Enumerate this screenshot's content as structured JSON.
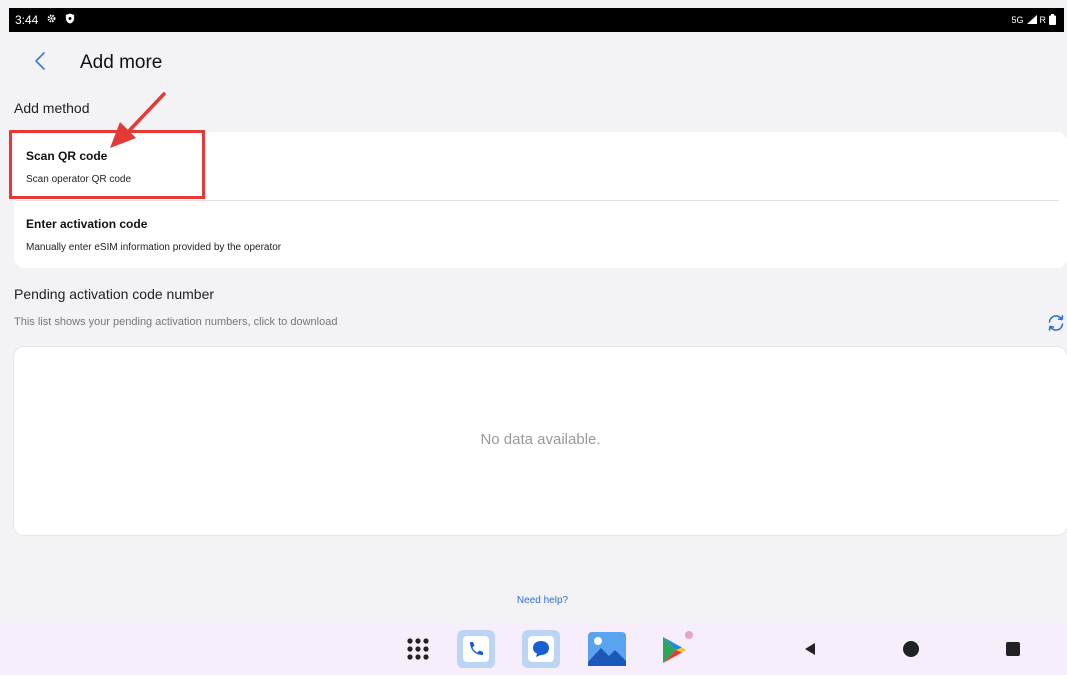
{
  "status_bar": {
    "time": "3:44",
    "network": "5G",
    "roaming": "R",
    "icons": [
      "gear-icon",
      "shield-icon",
      "signal-icon",
      "battery-icon"
    ]
  },
  "header": {
    "title": "Add more",
    "back_icon": "chevron-left-icon"
  },
  "add_method": {
    "section_title": "Add method",
    "items": [
      {
        "title": "Scan QR code",
        "description": "Scan operator QR code"
      },
      {
        "title": "Enter activation code",
        "description": "Manually enter eSIM information provided by the operator"
      }
    ]
  },
  "pending": {
    "section_title": "Pending activation code number",
    "hint": "This list shows your pending activation numbers, click to download",
    "refresh_icon": "refresh-icon",
    "empty_text": "No data available."
  },
  "help_link": "Need help?",
  "nav_bar": {
    "dock_apps": [
      "app-drawer-icon",
      "phone-icon",
      "messages-icon",
      "gallery-icon",
      "play-store-icon"
    ],
    "buttons": [
      "back-nav-icon",
      "home-icon",
      "recents-icon"
    ]
  },
  "colors": {
    "accent": "#2f6fd6",
    "annotation": "#e53935",
    "background": "#f3f3f6",
    "nav_bar": "#f6eefa"
  }
}
